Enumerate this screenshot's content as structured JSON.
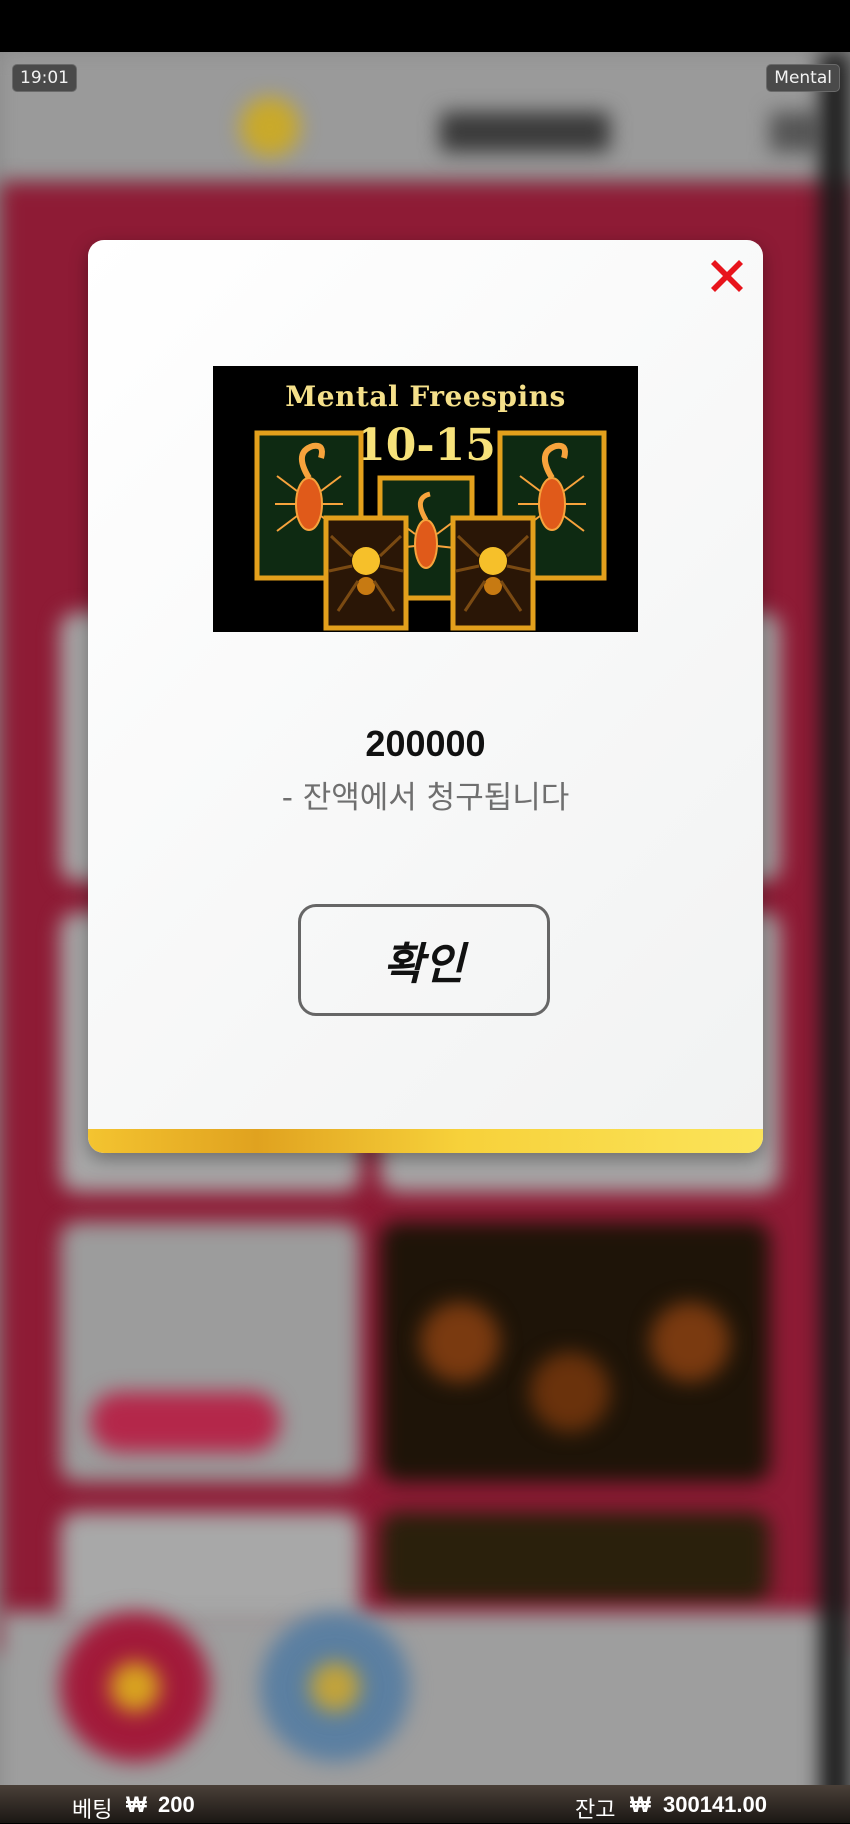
{
  "top_overlay": {
    "time": "19:01",
    "game": "Mental"
  },
  "modal": {
    "banner": {
      "title": "Mental Freespins",
      "range": "10-15"
    },
    "amount": "200000",
    "note": "- 잔액에서 청구됩니다",
    "confirm_label": "확인",
    "close_icon": "close-x-icon",
    "accent_color": "#e8141c"
  },
  "status_bar": {
    "bet_label": "베팅",
    "bet_currency": "₩",
    "bet_value": "200",
    "balance_label": "잔고",
    "balance_currency": "₩",
    "balance_value": "300141.00"
  }
}
